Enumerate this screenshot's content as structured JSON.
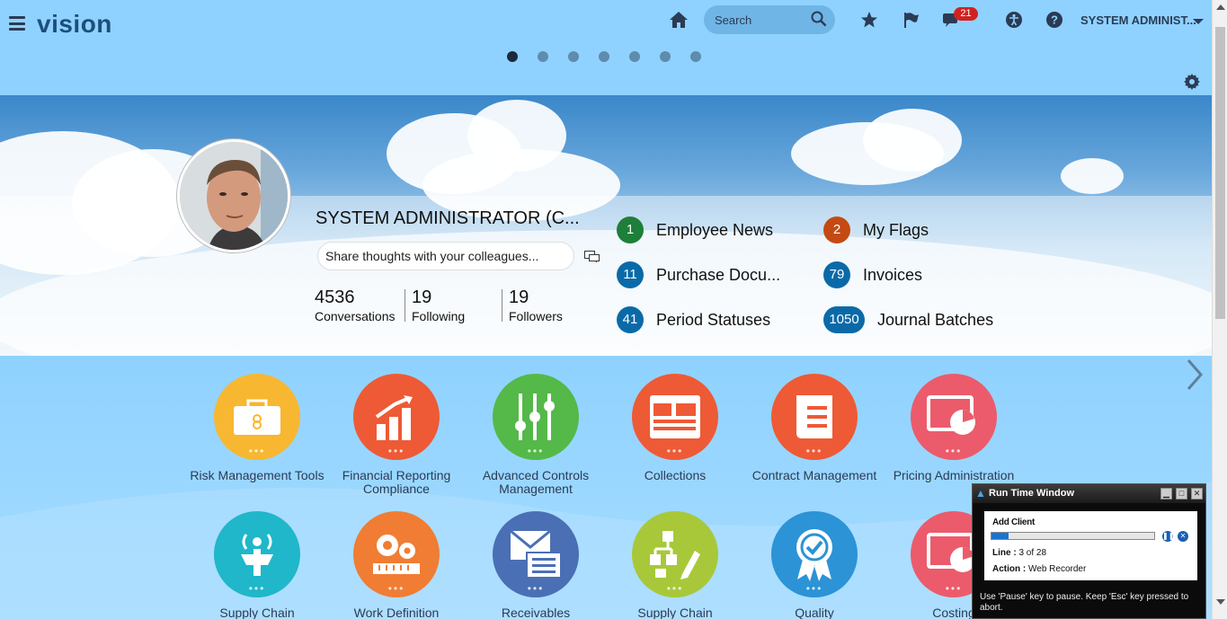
{
  "header": {
    "logo": "vision",
    "search_placeholder": "Search",
    "notifications_count": "21",
    "user_name": "SYSTEM ADMINIST...",
    "springboard_pages": 7,
    "active_page": 1
  },
  "profile": {
    "name": "SYSTEM ADMINISTRATOR (C...",
    "share_placeholder": "Share thoughts with your colleagues...",
    "stats": [
      {
        "value": "4536",
        "label": "Conversations"
      },
      {
        "value": "19",
        "label": "Following"
      },
      {
        "value": "19",
        "label": "Followers"
      }
    ]
  },
  "worklists": [
    {
      "count": "1",
      "label": "Employee News",
      "color": "#1e7f3a"
    },
    {
      "count": "2",
      "label": "My Flags",
      "color": "#c44a12"
    },
    {
      "count": "11",
      "label": "Purchase Docu...",
      "color": "#0a6aa8"
    },
    {
      "count": "79",
      "label": "Invoices",
      "color": "#0a6aa8"
    },
    {
      "count": "41",
      "label": "Period Statuses",
      "color": "#0a6aa8"
    },
    {
      "count": "1050",
      "label": "Journal Batches",
      "color": "#0a6aa8"
    }
  ],
  "tiles_row1": [
    {
      "label": "Risk Management Tools",
      "color": "#f7b731",
      "icon": "briefcase-icon"
    },
    {
      "label": "Financial Reporting Compliance",
      "color": "#ee5a35",
      "icon": "bar-chart-icon"
    },
    {
      "label": "Advanced Controls Management",
      "color": "#54b948",
      "icon": "sliders-icon"
    },
    {
      "label": "Collections",
      "color": "#ee5a35",
      "icon": "dashboard-icon"
    },
    {
      "label": "Contract Management",
      "color": "#ee5a35",
      "icon": "scroll-icon"
    },
    {
      "label": "Pricing Administration",
      "color": "#ec5b6b",
      "icon": "pricing-icon"
    }
  ],
  "tiles_row2": [
    {
      "label": "Supply Chain",
      "color": "#1fb7c9",
      "icon": "antenna-icon"
    },
    {
      "label": "Work Definition",
      "color": "#f07d33",
      "icon": "gears-icon"
    },
    {
      "label": "Receivables",
      "color": "#4a6fb5",
      "icon": "envelope-icon"
    },
    {
      "label": "Supply Chain",
      "color": "#a8c83a",
      "icon": "org-chart-icon"
    },
    {
      "label": "Quality",
      "color": "#2b93d6",
      "icon": "badge-icon"
    },
    {
      "label": "Costing",
      "color": "#ec5b6b",
      "icon": "pricing-icon"
    }
  ],
  "runtime": {
    "title": "Run Time Window",
    "heading": "Add Client",
    "progress": 0.107,
    "line_label": "Line :",
    "line_value": "3 of 28",
    "action_label": "Action :",
    "action_value": "Web Recorder",
    "footer": "Use 'Pause' key to pause. Keep 'Esc' key pressed to abort."
  }
}
